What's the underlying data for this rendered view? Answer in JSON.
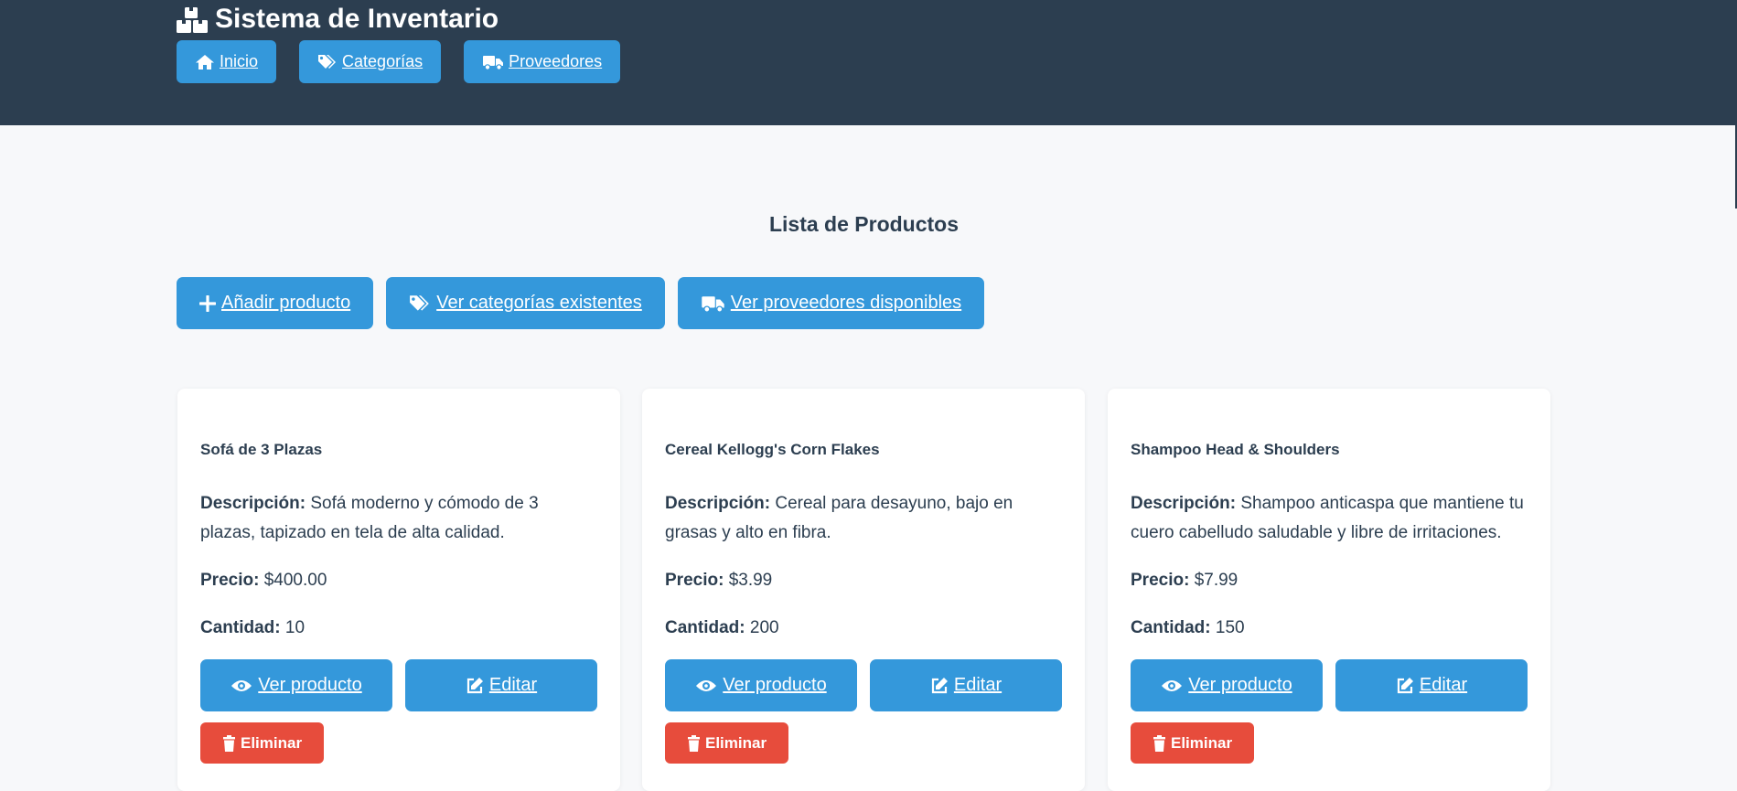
{
  "header": {
    "brand": "Sistema de Inventario",
    "nav": [
      {
        "label": "Inicio",
        "icon": "home-icon"
      },
      {
        "label": "Categorías",
        "icon": "tags-icon"
      },
      {
        "label": "Proveedores",
        "icon": "truck-icon"
      }
    ]
  },
  "main": {
    "title": "Lista de Productos",
    "actions": [
      {
        "label": "Añadir producto",
        "icon": "plus-icon"
      },
      {
        "label": "Ver categorías existentes",
        "icon": "tags-icon"
      },
      {
        "label": "Ver proveedores disponibles",
        "icon": "truck-icon"
      }
    ]
  },
  "labels": {
    "description": "Descripción:",
    "price": "Precio:",
    "quantity": "Cantidad:",
    "view": "Ver producto",
    "edit": "Editar",
    "delete": "Eliminar"
  },
  "products": [
    {
      "name": "Sofá de 3 Plazas",
      "description": "Sofá moderno y cómodo de 3 plazas, tapizado en tela de alta calidad.",
      "price": "$400.00",
      "quantity": "10"
    },
    {
      "name": "Cereal Kellogg's Corn Flakes",
      "description": "Cereal para desayuno, bajo en grasas y alto en fibra.",
      "price": "$3.99",
      "quantity": "200"
    },
    {
      "name": "Shampoo Head & Shoulders",
      "description": "Shampoo anticaspa que mantiene tu cuero cabelludo saludable y libre de irritaciones.",
      "price": "$7.99",
      "quantity": "150"
    }
  ],
  "colors": {
    "header_bg": "#2c3e50",
    "primary": "#3498db",
    "danger": "#e74c3c",
    "page_bg": "#f7f8fa"
  }
}
